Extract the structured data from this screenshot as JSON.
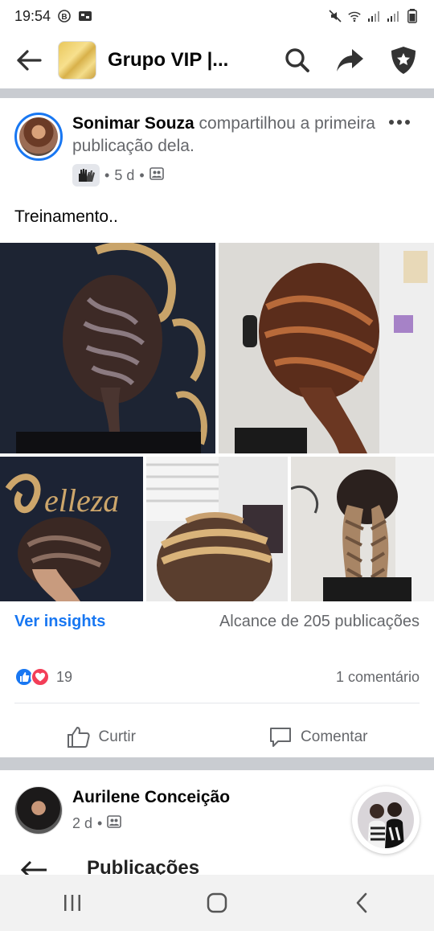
{
  "status_bar": {
    "time": "19:54",
    "icons": [
      "b-badge-icon",
      "screenshot-icon",
      "mute-icon",
      "wifi-icon",
      "signal-icon",
      "signal-icon",
      "battery-icon"
    ]
  },
  "header": {
    "title": "Grupo VIP |...",
    "icons": [
      "back-arrow-icon",
      "search-icon",
      "share-icon",
      "shield-star-icon"
    ]
  },
  "post": {
    "author": "Sonimar Souza",
    "action_text": " compartilhou a primeira publicação dela.",
    "time": "5 d",
    "separator": "•",
    "text": "Treinamento..",
    "insights_label": "Ver insights",
    "reach_label": "Alcance de 205 publicações",
    "reactions_count": "19",
    "comments_label": "1 comentário",
    "like_label": "Curtir",
    "comment_label": "Comentar"
  },
  "post2": {
    "author": "Aurilene Conceição",
    "time": "2 d",
    "separator": "•"
  },
  "sheet": {
    "title": "Publicações"
  },
  "colors": {
    "accent": "#1877f2",
    "love": "#f33e58",
    "divider": "#c9ccd1",
    "secondary_text": "#65676b"
  }
}
